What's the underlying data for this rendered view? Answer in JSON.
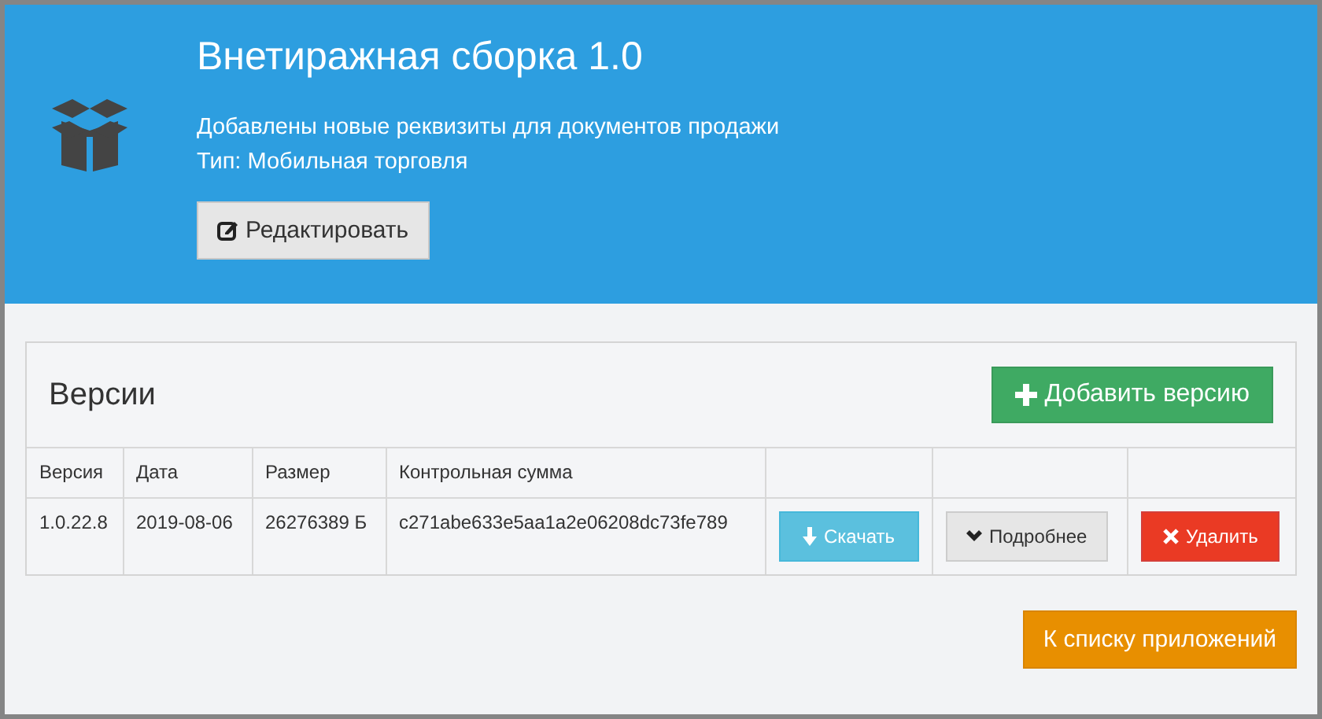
{
  "app": {
    "title": "Внетиражная сборка 1.0",
    "description": "Добавлены новые реквизиты для документов продажи",
    "type_line": "Тип: Мобильная торговля",
    "edit_button": {
      "label": "Редактировать",
      "kind": "edit"
    }
  },
  "versions": {
    "title": "Версии",
    "add_button": {
      "label": "Добавить версию",
      "kind": "add"
    },
    "columns": [
      "Версия",
      "Дата",
      "Размер",
      "Контрольная сумма"
    ],
    "rows": [
      {
        "cells": [
          "1.0.22.8",
          "2019-08-06",
          "26276389 Б",
          "c271abe633e5aa1a2e06208dc73fe789"
        ],
        "actions": [
          {
            "label": "Скачать",
            "kind": "download"
          },
          {
            "label": "Подробнее",
            "kind": "details"
          },
          {
            "label": "Удалить",
            "kind": "delete"
          }
        ]
      }
    ]
  },
  "back_button": {
    "label": "К списку приложений",
    "kind": "back"
  }
}
